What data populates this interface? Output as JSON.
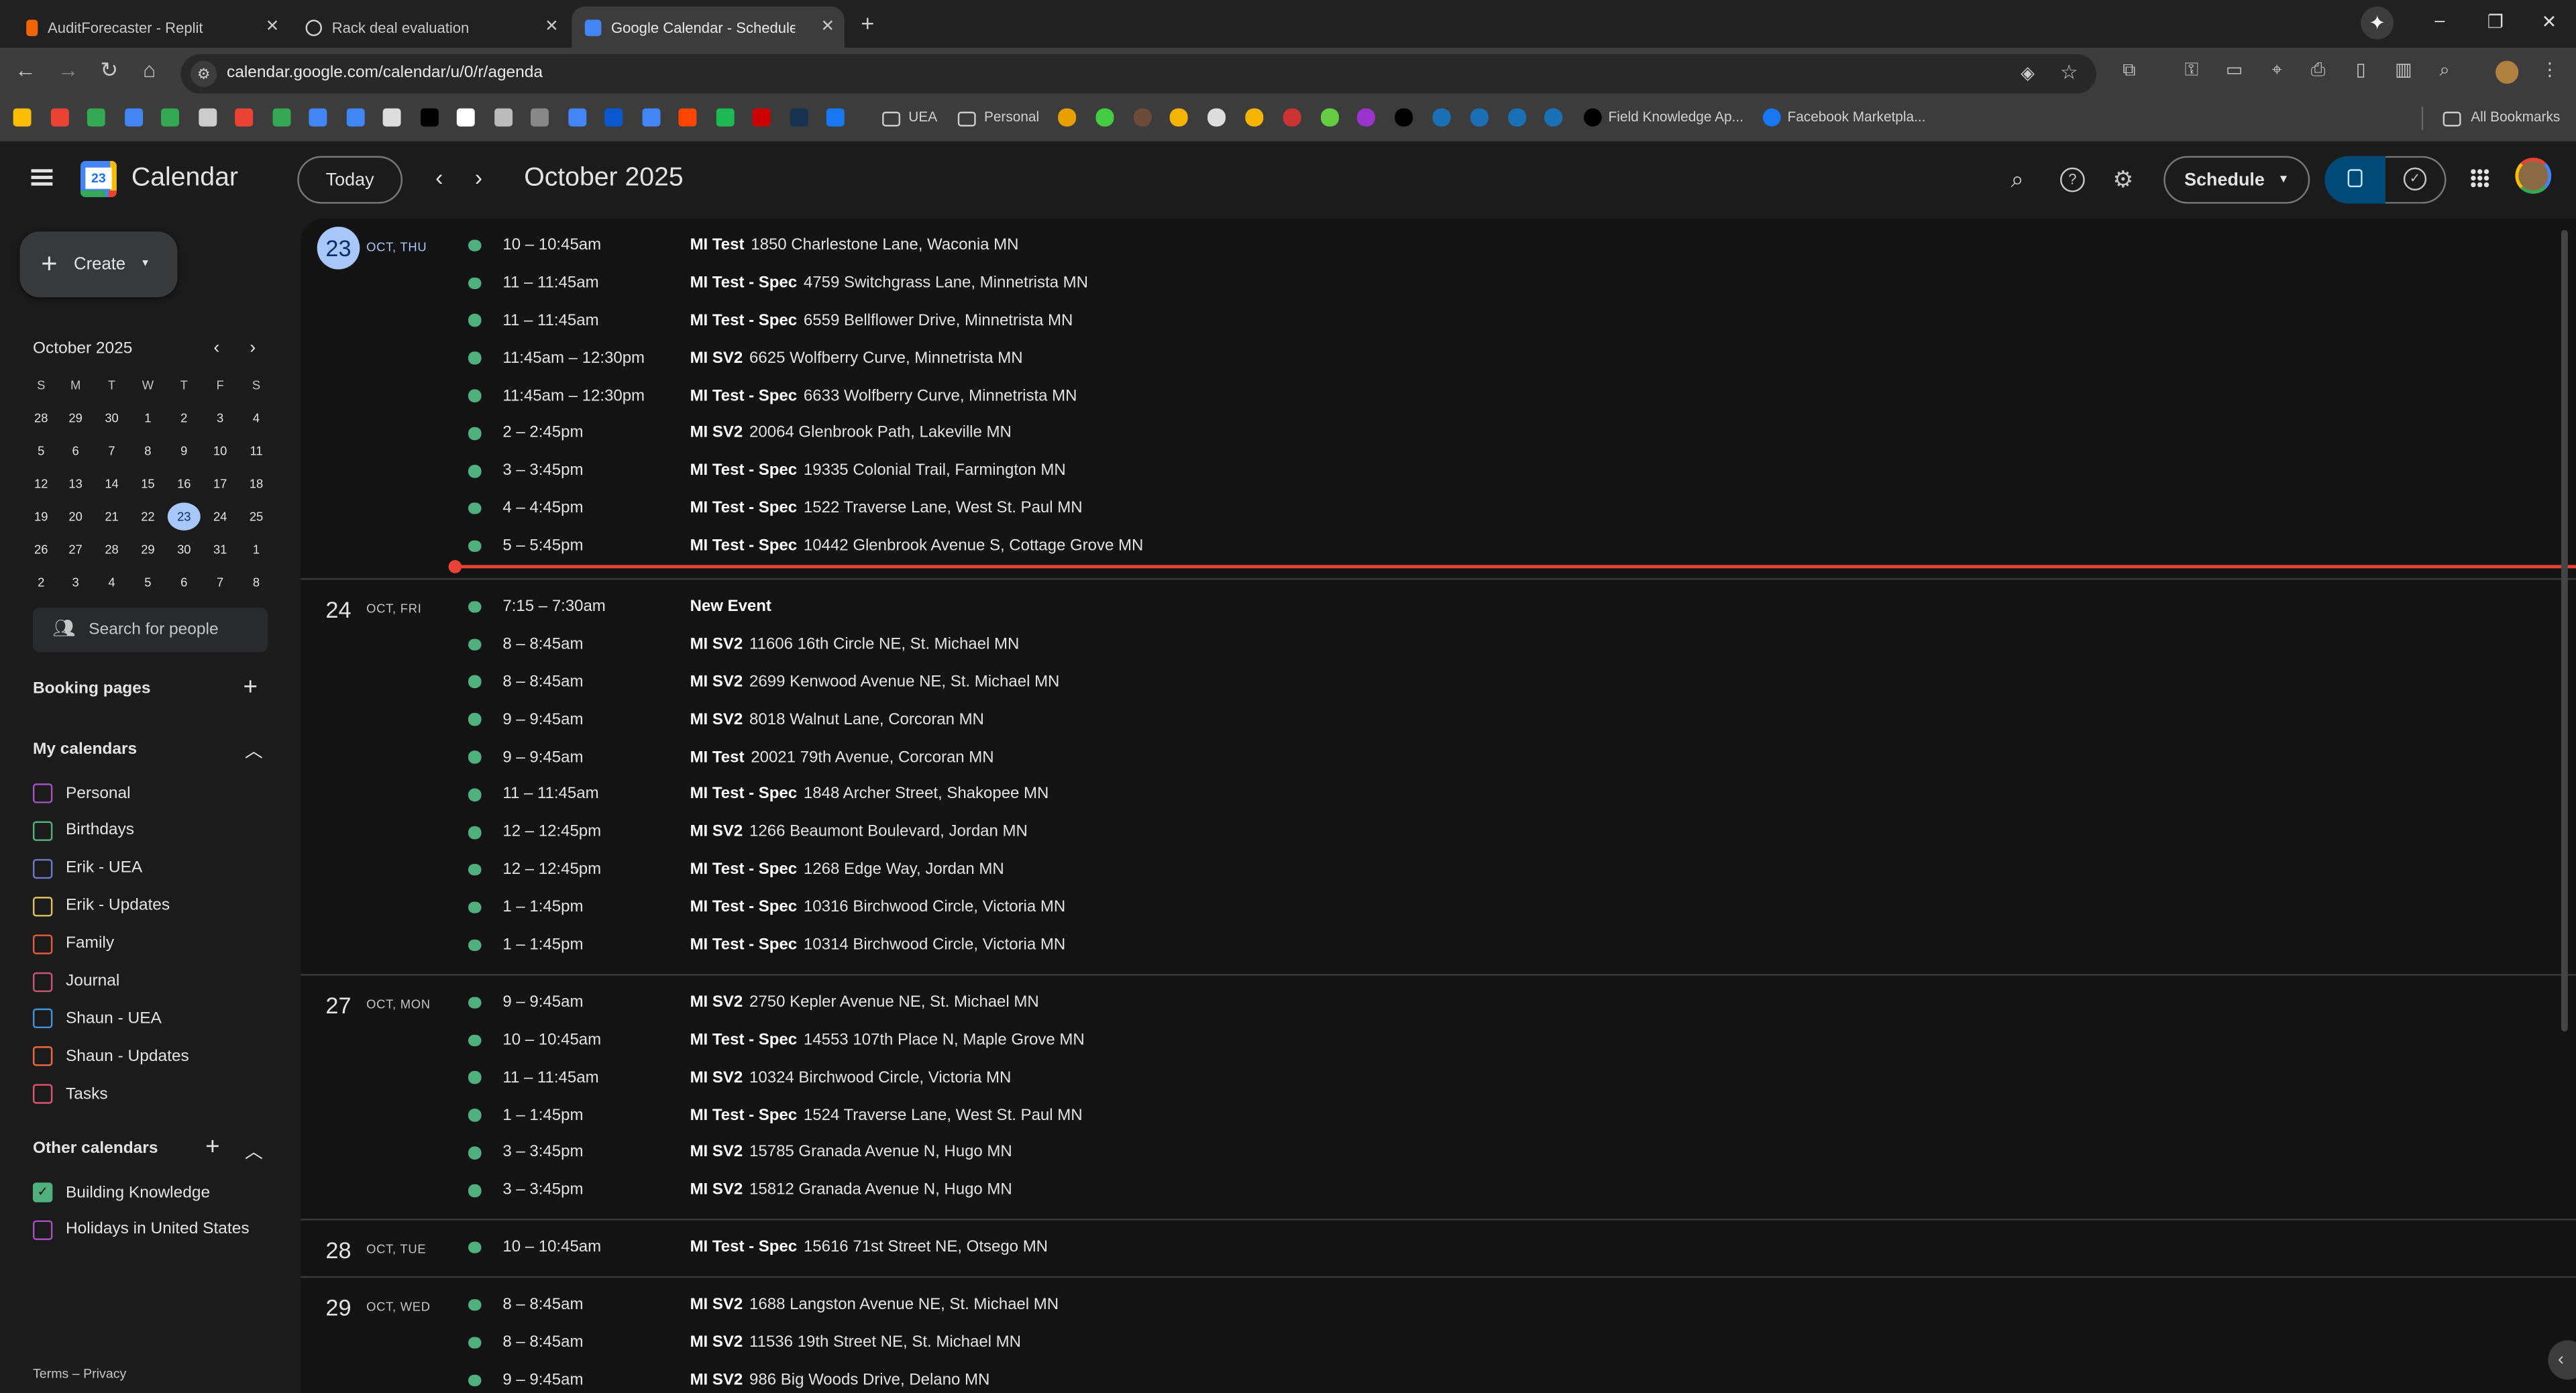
{
  "browser": {
    "tabs": [
      {
        "title": "AuditForecaster - Replit",
        "icon_color": "#f26207"
      },
      {
        "title": "Rack deal evaluation",
        "icon_color": "#d0d0d0"
      },
      {
        "title": "Google Calendar - Schedule sta",
        "icon_color": "#4285f4",
        "active": true
      }
    ],
    "new_tab": "+",
    "url": "calendar.google.com/calendar/u/0/r/agenda",
    "bookmark_icons": [
      "#fbbc04",
      "#ea4335",
      "#34a853",
      "#4285f4",
      "#34a853",
      "#cccccc",
      "#ea4335",
      "#34a853",
      "#4285f4",
      "#4285f4",
      "#dddddd",
      "#000000",
      "#ffffff",
      "#bbbbbb",
      "#888888",
      "#4285f4",
      "#0a58d0",
      "#4285f4",
      "#ff4500",
      "#1db954",
      "#cc0000",
      "#16324f",
      "#1877f2"
    ],
    "bookmark_icons_2": [
      "#e8a000",
      "#44cc44",
      "#6b4a3a",
      "#f5b400",
      "#dddddd",
      "#f5b400",
      "#cc3333",
      "#66cc44",
      "#9933cc",
      "#000000",
      "#1a6fb5",
      "#1a6fb5",
      "#1a6fb5",
      "#1a6fb5"
    ],
    "bookmark_folders": [
      "UEA",
      "Personal"
    ],
    "bookmarks": [
      "Field Knowledge Ap...",
      "Facebook Marketpla..."
    ],
    "all_bookmarks": "All Bookmarks"
  },
  "header": {
    "app_name": "Calendar",
    "logo_day": "23",
    "today_button": "Today",
    "title": "October 2025",
    "view_selector": "Schedule",
    "accent": "#a8c7fa"
  },
  "sidebar": {
    "create": "Create",
    "mini_calendar": {
      "title": "October 2025",
      "weekdays": [
        "S",
        "M",
        "T",
        "W",
        "T",
        "F",
        "S"
      ],
      "weeks": [
        [
          "28",
          "29",
          "30",
          "1",
          "2",
          "3",
          "4"
        ],
        [
          "5",
          "6",
          "7",
          "8",
          "9",
          "10",
          "11"
        ],
        [
          "12",
          "13",
          "14",
          "15",
          "16",
          "17",
          "18"
        ],
        [
          "19",
          "20",
          "21",
          "22",
          "23",
          "24",
          "25"
        ],
        [
          "26",
          "27",
          "28",
          "29",
          "30",
          "31",
          "1"
        ],
        [
          "2",
          "3",
          "4",
          "5",
          "6",
          "7",
          "8"
        ]
      ],
      "today": "23"
    },
    "search_people": "Search for people",
    "booking_pages": "Booking pages",
    "my_calendars": {
      "title": "My calendars",
      "items": [
        {
          "label": "Personal",
          "color": "#a64fc4",
          "checked": false
        },
        {
          "label": "Birthdays",
          "color": "#4fb07e",
          "checked": false
        },
        {
          "label": "Erik - UEA",
          "color": "#7275c9",
          "checked": false
        },
        {
          "label": "Erik - Updates",
          "color": "#e2c15a",
          "checked": false
        },
        {
          "label": "Family",
          "color": "#e25a3a",
          "checked": false
        },
        {
          "label": "Journal",
          "color": "#c45678",
          "checked": false
        },
        {
          "label": "Shaun - UEA",
          "color": "#3f93d8",
          "checked": false
        },
        {
          "label": "Shaun - Updates",
          "color": "#ec6a3a",
          "checked": false
        },
        {
          "label": "Tasks",
          "color": "#e05272",
          "checked": false
        }
      ]
    },
    "other_calendars": {
      "title": "Other calendars",
      "items": [
        {
          "label": "Building Knowledge",
          "color": "#4fb07e",
          "checked": true
        },
        {
          "label": "Holidays in United States",
          "color": "#a64fc4",
          "checked": false
        }
      ]
    },
    "footer": "Terms – Privacy"
  },
  "agenda": {
    "event_color": "#4fb07e",
    "days": [
      {
        "num": "23",
        "label": "OCT, THU",
        "today": true,
        "events": [
          {
            "time": "10 – 10:45am",
            "title": "MI Test",
            "location": "1850 Charlestone Lane, Waconia MN"
          },
          {
            "time": "11 – 11:45am",
            "title": "MI Test - Spec",
            "location": "4759 Switchgrass Lane, Minnetrista MN"
          },
          {
            "time": "11 – 11:45am",
            "title": "MI Test - Spec",
            "location": "6559 Bellflower Drive, Minnetrista MN"
          },
          {
            "time": "11:45am – 12:30pm",
            "title": "MI SV2",
            "location": "6625 Wolfberry Curve, Minnetrista MN"
          },
          {
            "time": "11:45am – 12:30pm",
            "title": "MI Test - Spec",
            "location": "6633 Wolfberry Curve, Minnetrista MN"
          },
          {
            "time": "2 – 2:45pm",
            "title": "MI SV2",
            "location": "20064 Glenbrook Path, Lakeville MN"
          },
          {
            "time": "3 – 3:45pm",
            "title": "MI Test - Spec",
            "location": "19335 Colonial Trail, Farmington MN"
          },
          {
            "time": "4 – 4:45pm",
            "title": "MI Test - Spec",
            "location": "1522 Traverse Lane, West St. Paul MN"
          },
          {
            "time": "5 – 5:45pm",
            "title": "MI Test - Spec",
            "location": "10442 Glenbrook Avenue S, Cottage Grove MN"
          }
        ]
      },
      {
        "num": "24",
        "label": "OCT, FRI",
        "events": [
          {
            "time": "7:15 – 7:30am",
            "title": "New Event",
            "location": ""
          },
          {
            "time": "8 – 8:45am",
            "title": "MI SV2",
            "location": "11606 16th Circle NE, St. Michael MN"
          },
          {
            "time": "8 – 8:45am",
            "title": "MI SV2",
            "location": "2699 Kenwood Avenue NE, St. Michael MN"
          },
          {
            "time": "9 – 9:45am",
            "title": "MI SV2",
            "location": "8018 Walnut Lane, Corcoran MN"
          },
          {
            "time": "9 – 9:45am",
            "title": "MI Test",
            "location": "20021 79th Avenue, Corcoran MN"
          },
          {
            "time": "11 – 11:45am",
            "title": "MI Test - Spec",
            "location": "1848 Archer Street, Shakopee MN"
          },
          {
            "time": "12 – 12:45pm",
            "title": "MI SV2",
            "location": "1266 Beaumont Boulevard, Jordan MN"
          },
          {
            "time": "12 – 12:45pm",
            "title": "MI Test - Spec",
            "location": "1268 Edge Way, Jordan MN"
          },
          {
            "time": "1 – 1:45pm",
            "title": "MI Test - Spec",
            "location": "10316 Birchwood Circle, Victoria MN"
          },
          {
            "time": "1 – 1:45pm",
            "title": "MI Test - Spec",
            "location": "10314 Birchwood Circle, Victoria MN"
          }
        ]
      },
      {
        "num": "27",
        "label": "OCT, MON",
        "events": [
          {
            "time": "9 – 9:45am",
            "title": "MI SV2",
            "location": "2750 Kepler Avenue NE, St. Michael MN"
          },
          {
            "time": "10 – 10:45am",
            "title": "MI Test - Spec",
            "location": "14553 107th Place N, Maple Grove MN"
          },
          {
            "time": "11 – 11:45am",
            "title": "MI SV2",
            "location": "10324 Birchwood Circle, Victoria MN"
          },
          {
            "time": "1 – 1:45pm",
            "title": "MI Test - Spec",
            "location": "1524 Traverse Lane, West St. Paul MN"
          },
          {
            "time": "3 – 3:45pm",
            "title": "MI SV2",
            "location": "15785 Granada Avenue N, Hugo MN"
          },
          {
            "time": "3 – 3:45pm",
            "title": "MI SV2",
            "location": "15812 Granada Avenue N, Hugo MN"
          }
        ]
      },
      {
        "num": "28",
        "label": "OCT, TUE",
        "events": [
          {
            "time": "10 – 10:45am",
            "title": "MI Test - Spec",
            "location": "15616 71st Street NE, Otsego MN"
          }
        ]
      },
      {
        "num": "29",
        "label": "OCT, WED",
        "events": [
          {
            "time": "8 – 8:45am",
            "title": "MI SV2",
            "location": "1688 Langston Avenue NE, St. Michael MN"
          },
          {
            "time": "8 – 8:45am",
            "title": "MI SV2",
            "location": "11536 19th Street NE, St. Michael MN"
          },
          {
            "time": "9 – 9:45am",
            "title": "MI SV2",
            "location": "986 Big Woods Drive, Delano MN"
          }
        ]
      }
    ]
  }
}
